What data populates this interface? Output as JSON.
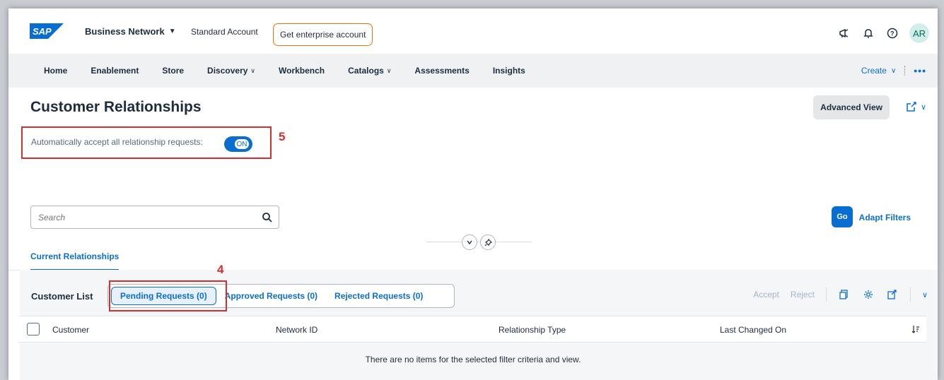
{
  "shell": {
    "product": "Business Network",
    "account_type": "Standard Account",
    "enterprise_btn": "Get enterprise account",
    "avatar": "AR"
  },
  "nav": {
    "items": [
      {
        "label": "Home",
        "dropdown": false
      },
      {
        "label": "Enablement",
        "dropdown": false
      },
      {
        "label": "Store",
        "dropdown": false
      },
      {
        "label": "Discovery",
        "dropdown": true
      },
      {
        "label": "Workbench",
        "dropdown": false
      },
      {
        "label": "Catalogs",
        "dropdown": true
      },
      {
        "label": "Assessments",
        "dropdown": false
      },
      {
        "label": "Insights",
        "dropdown": false
      }
    ],
    "create": "Create",
    "more": "•••"
  },
  "header": {
    "title": "Customer Relationships",
    "advanced_view": "Advanced View",
    "auto_accept_label": "Automatically accept all relationship requests:",
    "toggle_state": "ON"
  },
  "annotations": {
    "step5": "5",
    "step4": "4"
  },
  "filter": {
    "search_placeholder": "Search",
    "go": "Go",
    "adapt_filters": "Adapt Filters"
  },
  "tabs": {
    "current": "Current Relationships"
  },
  "table": {
    "title": "Customer List",
    "segments": [
      "Pending Requests (0)",
      "Approved Requests (0)",
      "Rejected Requests (0)"
    ],
    "accept": "Accept",
    "reject": "Reject",
    "columns": [
      "Customer",
      "Network ID",
      "Relationship Type",
      "Last Changed On"
    ],
    "no_data": "There are no items for the selected filter criteria and view."
  },
  "colors": {
    "brand": "#0a6ed1",
    "annotation": "#d32f2f",
    "enterprise_border": "#e9730c"
  }
}
